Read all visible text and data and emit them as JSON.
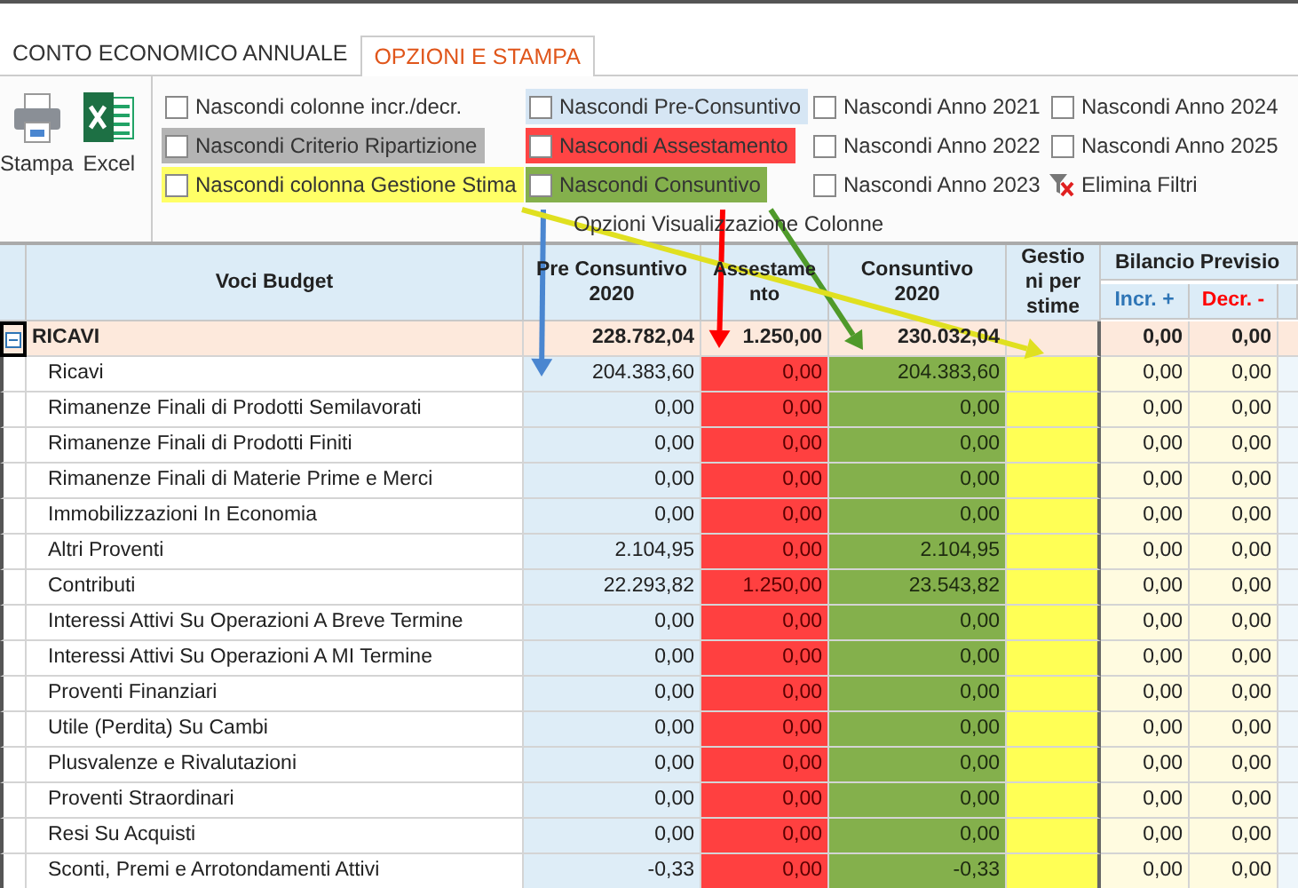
{
  "tabs": [
    {
      "label": "CONTO ECONOMICO ANNUALE",
      "selected": false
    },
    {
      "label": "OPZIONI E STAMPA",
      "selected": true
    }
  ],
  "ribbon": {
    "buttons": [
      {
        "label": "Stampa",
        "kind": "print"
      },
      {
        "label": "Excel",
        "kind": "excel"
      }
    ],
    "options": [
      {
        "kind": "checkbox",
        "label": "Nascondi colonne incr./decr.",
        "checked": false
      },
      {
        "kind": "checkbox",
        "label": "Nascondi Criterio Ripartizione",
        "checked": false,
        "color": "#b4b4b4"
      },
      {
        "kind": "checkbox",
        "label": "Nascondi colonna Gestione Stima",
        "checked": false,
        "color": "#ffff66"
      },
      {
        "kind": "checkbox",
        "label": "Nascondi Pre-Consuntivo",
        "checked": false,
        "color": "#d6e6f4"
      },
      {
        "kind": "checkbox",
        "label": "Nascondi Assestamento",
        "checked": false,
        "color": "#ff4444"
      },
      {
        "kind": "checkbox",
        "label": "Nascondi Consuntivo",
        "checked": false,
        "color": "#84b04c"
      },
      {
        "kind": "checkbox",
        "label": "Nascondi Anno 2021",
        "checked": false
      },
      {
        "kind": "checkbox",
        "label": "Nascondi Anno 2022",
        "checked": false
      },
      {
        "kind": "checkbox",
        "label": "Nascondi Anno 2023",
        "checked": false
      },
      {
        "kind": "checkbox",
        "label": "Nascondi Anno 2024",
        "checked": false
      },
      {
        "kind": "checkbox",
        "label": "Nascondi  Anno 2025",
        "checked": false
      },
      {
        "kind": "action",
        "label": "Elimina Filtri"
      }
    ],
    "group_caption": "Opzioni Visualizzazione Colonne"
  },
  "table": {
    "columns": [
      {
        "label": "Voci Budget"
      },
      {
        "label": "Pre Consuntivo 2020",
        "color": "#deedf7"
      },
      {
        "label": "Assestamento",
        "color": "#ff4040"
      },
      {
        "label": "Consuntivo 2020",
        "color": "#84b04c"
      },
      {
        "label": "Gestioni per stime",
        "color": "#ffff55"
      },
      {
        "label": "Incr. +",
        "kind": "sub",
        "color": "#2e75b6"
      },
      {
        "label": "Decr. -",
        "kind": "sub",
        "color": "#ff0000"
      }
    ],
    "group_header": "Bilancio Previsio",
    "rows": [
      {
        "kind": "group",
        "expanded": true,
        "cells": [
          "RICAVI",
          "228.782,04",
          "1.250,00",
          "230.032,04",
          "",
          "0,00",
          "0,00"
        ]
      },
      {
        "kind": "item",
        "cells": [
          "Ricavi",
          "204.383,60",
          "0,00",
          "204.383,60",
          "",
          "0,00",
          "0,00"
        ]
      },
      {
        "kind": "item",
        "cells": [
          "Rimanenze Finali di Prodotti Semilavorati",
          "0,00",
          "0,00",
          "0,00",
          "",
          "0,00",
          "0,00"
        ]
      },
      {
        "kind": "item",
        "cells": [
          "Rimanenze Finali di Prodotti Finiti",
          "0,00",
          "0,00",
          "0,00",
          "",
          "0,00",
          "0,00"
        ]
      },
      {
        "kind": "item",
        "cells": [
          "Rimanenze Finali di Materie Prime e Merci",
          "0,00",
          "0,00",
          "0,00",
          "",
          "0,00",
          "0,00"
        ]
      },
      {
        "kind": "item",
        "cells": [
          "Immobilizzazioni In Economia",
          "0,00",
          "0,00",
          "0,00",
          "",
          "0,00",
          "0,00"
        ]
      },
      {
        "kind": "item",
        "cells": [
          "Altri Proventi",
          "2.104,95",
          "0,00",
          "2.104,95",
          "",
          "0,00",
          "0,00"
        ]
      },
      {
        "kind": "item",
        "cells": [
          "Contributi",
          "22.293,82",
          "1.250,00",
          "23.543,82",
          "",
          "0,00",
          "0,00"
        ]
      },
      {
        "kind": "item",
        "cells": [
          "Interessi Attivi Su Operazioni A Breve Termine",
          "0,00",
          "0,00",
          "0,00",
          "",
          "0,00",
          "0,00"
        ]
      },
      {
        "kind": "item",
        "cells": [
          "Interessi Attivi Su Operazioni A MI Termine",
          "0,00",
          "0,00",
          "0,00",
          "",
          "0,00",
          "0,00"
        ]
      },
      {
        "kind": "item",
        "cells": [
          "Proventi Finanziari",
          "0,00",
          "0,00",
          "0,00",
          "",
          "0,00",
          "0,00"
        ]
      },
      {
        "kind": "item",
        "cells": [
          "Utile (Perdita) Su Cambi",
          "0,00",
          "0,00",
          "0,00",
          "",
          "0,00",
          "0,00"
        ]
      },
      {
        "kind": "item",
        "cells": [
          "Plusvalenze e Rivalutazioni",
          "0,00",
          "0,00",
          "0,00",
          "",
          "0,00",
          "0,00"
        ]
      },
      {
        "kind": "item",
        "cells": [
          "Proventi Straordinari",
          "0,00",
          "0,00",
          "0,00",
          "",
          "0,00",
          "0,00"
        ]
      },
      {
        "kind": "item",
        "cells": [
          "Resi Su Acquisti",
          "0,00",
          "0,00",
          "0,00",
          "",
          "0,00",
          "0,00"
        ]
      },
      {
        "kind": "item",
        "cells": [
          "Sconti, Premi e Arrotondamenti  Attivi",
          "-0,33",
          "0,00",
          "-0,33",
          "",
          "0,00",
          "0,00"
        ]
      }
    ]
  },
  "annotations": [
    {
      "kind": "arrow",
      "color": "#4a86d0"
    },
    {
      "kind": "arrow",
      "color": "#ff0000"
    },
    {
      "kind": "arrow",
      "color": "#4f9a2a"
    },
    {
      "kind": "arrow",
      "color": "#e0e020"
    }
  ]
}
